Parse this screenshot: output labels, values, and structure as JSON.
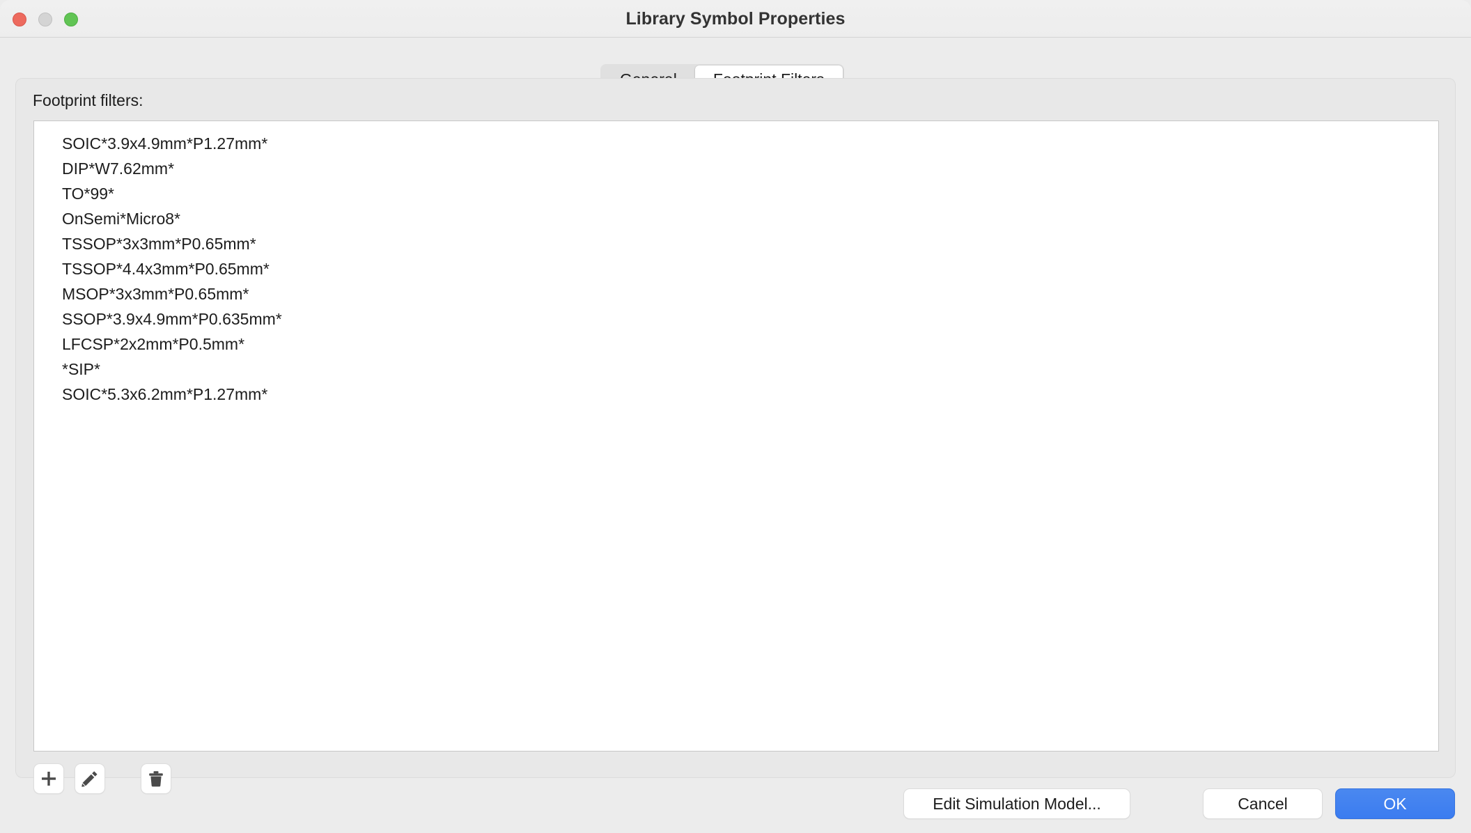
{
  "window": {
    "title": "Library Symbol Properties",
    "controls": {
      "close": "close-button",
      "minimize": "minimize-button",
      "maximize": "maximize-button"
    }
  },
  "tabs": [
    {
      "label": "General",
      "active": false
    },
    {
      "label": "Footprint Filters",
      "active": true
    }
  ],
  "panel": {
    "filters_label": "Footprint filters:",
    "filters": [
      "SOIC*3.9x4.9mm*P1.27mm*",
      "DIP*W7.62mm*",
      "TO*99*",
      "OnSemi*Micro8*",
      "TSSOP*3x3mm*P0.65mm*",
      "TSSOP*4.4x3mm*P0.65mm*",
      "MSOP*3x3mm*P0.65mm*",
      "SSOP*3.9x4.9mm*P0.635mm*",
      "LFCSP*2x2mm*P0.5mm*",
      "*SIP*",
      "SOIC*5.3x6.2mm*P1.27mm*"
    ]
  },
  "toolbar": {
    "add_icon": "plus-icon",
    "edit_icon": "pencil-icon",
    "delete_icon": "trash-icon"
  },
  "actions": {
    "edit_simulation_model": "Edit Simulation Model...",
    "cancel": "Cancel",
    "ok": "OK"
  },
  "colors": {
    "accent": "#3b7cf0",
    "window_bg": "#ececec",
    "panel_bg": "#e8e8e8",
    "list_bg": "#ffffff",
    "close": "#ed6a5e",
    "minimize": "#d4d4d4",
    "maximize": "#61c454"
  }
}
